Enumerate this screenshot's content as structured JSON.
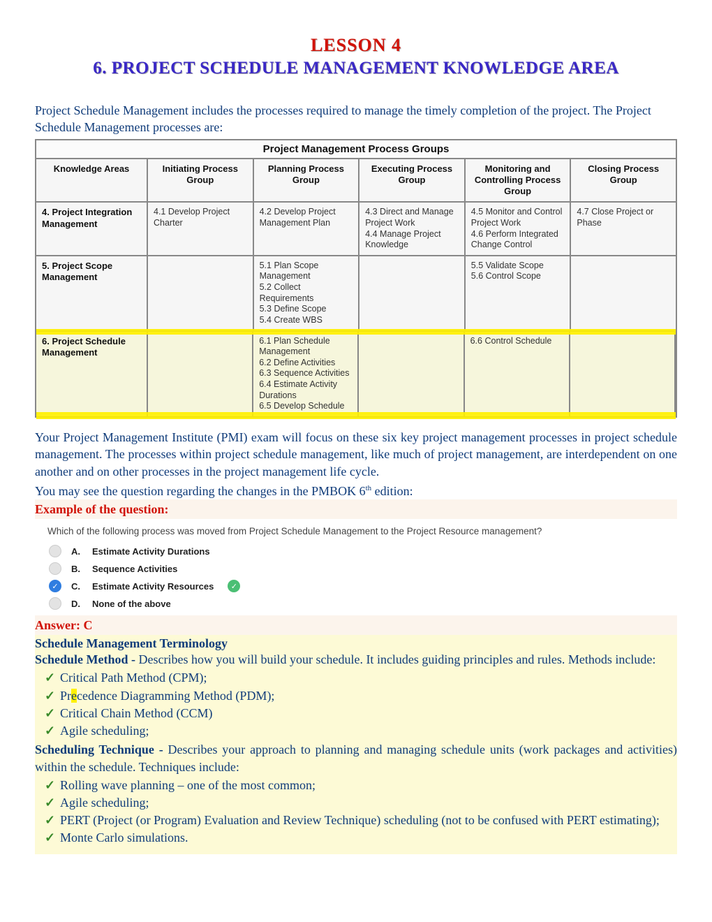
{
  "lesson_label": "LESSON 4",
  "section_heading": "6. PROJECT SCHEDULE MANAGEMENT KNOWLEDGE AREA",
  "intro_text": "Project Schedule Management includes the processes required to manage the timely completion of the project. The Project Schedule Management processes are:",
  "table": {
    "caption": "Project Management Process Groups",
    "ka_header": "Knowledge Areas",
    "columns": [
      "Initiating Process Group",
      "Planning Process Group",
      "Executing Process Group",
      "Monitoring and Controlling Process Group",
      "Closing Process Group"
    ],
    "rows": [
      {
        "ka": "4. Project Integration Management",
        "cells": [
          "4.1 Develop Project Charter",
          "4.2 Develop Project Management Plan",
          "4.3 Direct and Manage Project Work\n4.4 Manage Project Knowledge",
          "4.5 Monitor and Control Project Work\n4.6 Perform Integrated Change Control",
          "4.7 Close Project or Phase"
        ]
      },
      {
        "ka": "5. Project Scope Management",
        "cells": [
          "",
          "5.1 Plan Scope Management\n5.2 Collect Requirements\n5.3 Define Scope\n5.4 Create WBS",
          "",
          "5.5 Validate Scope\n5.6 Control Scope",
          ""
        ]
      },
      {
        "ka": "6. Project Schedule Management",
        "highlight": true,
        "cells": [
          "",
          "6.1 Plan Schedule Management\n6.2 Define Activities\n6.3 Sequence Activities\n6.4 Estimate Activity Durations\n6.5 Develop Schedule",
          "",
          "6.6 Control Schedule",
          ""
        ]
      }
    ]
  },
  "body_para": "Your Project Management Institute (PMI) exam will focus on these six key project management processes in project schedule management. The processes within project schedule management, like much of project management, are interdependent on one another and on other processes in the project management life cycle.",
  "pmbok_line_prefix": "You may see the question regarding the changes in the PMBOK 6",
  "pmbok_sup": "th",
  "pmbok_line_suffix": " edition:",
  "example_label": "Example of the question:",
  "question_text": "Which of the following process was moved from Project Schedule Management to the Project Resource management?",
  "options": [
    {
      "letter": "A.",
      "text": "Estimate Activity Durations",
      "selected": false,
      "correct": false
    },
    {
      "letter": "B.",
      "text": "Sequence Activities",
      "selected": false,
      "correct": false
    },
    {
      "letter": "C.",
      "text": "Estimate Activity Resources",
      "selected": true,
      "correct": true
    },
    {
      "letter": "D.",
      "text": "None of the above",
      "selected": false,
      "correct": false
    }
  ],
  "answer_label": "Answer: C",
  "terminology_heading": "Schedule Management Terminology",
  "schedule_method_label": "Schedule Method - ",
  "schedule_method_text": "Describes how you will build your schedule. It includes guiding principles and rules. Methods include:",
  "schedule_method_items": [
    "Critical Path Method (CPM);",
    "Precedence Diagramming Method (PDM);",
    "Critical Chain Method (CCM)",
    "Agile scheduling;"
  ],
  "precedence_hl_char": "e",
  "scheduling_technique_label": "Scheduling Technique - ",
  "scheduling_technique_text": "Describes your approach to planning and managing schedule units (work packages and activities) within the schedule. Techniques include:",
  "scheduling_technique_items": [
    "Rolling wave planning – one of the most common;",
    "Agile scheduling;",
    "PERT (Project (or Program) Evaluation and Review Technique) scheduling (not to be confused with PERT estimating);",
    "Monte Carlo simulations."
  ]
}
